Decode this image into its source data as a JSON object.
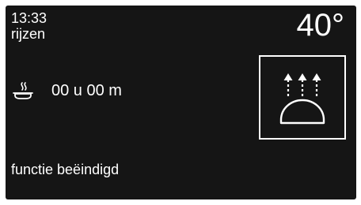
{
  "display": {
    "time": "13:33",
    "mode": "rijzen",
    "temperature": "40°",
    "timer_icon": "plate-heat-icon",
    "timer": "00 u 00 m",
    "program_icon": "proofing-dome-icon",
    "status": "functie beëindigd"
  },
  "colors": {
    "background": "#151515",
    "text": "#ffffff"
  }
}
